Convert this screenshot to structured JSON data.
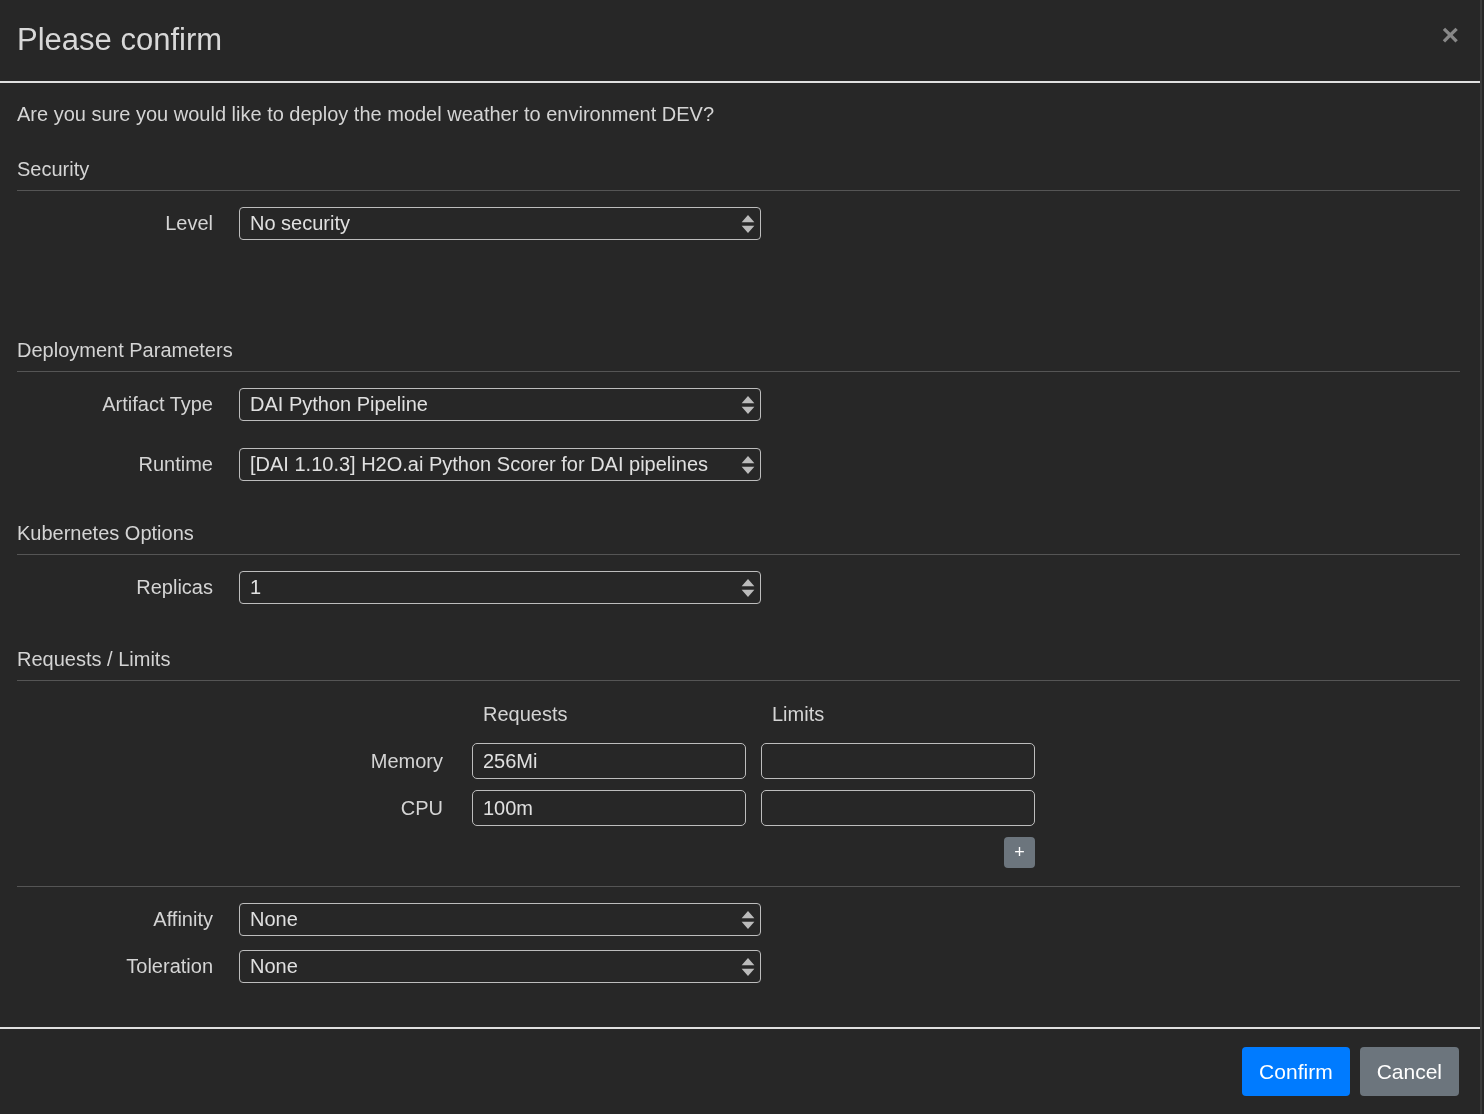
{
  "dialog": {
    "title": "Please confirm",
    "close": "×",
    "message": "Are you sure you would like to deploy the model weather to environment DEV?",
    "sections": [
      {
        "kind": "fields",
        "title": "Security",
        "fields": [
          {
            "label": "Level",
            "value": "No security"
          }
        ]
      },
      {
        "kind": "fields",
        "title": "Deployment Parameters",
        "fields": [
          {
            "label": "Artifact Type",
            "value": "DAI Python Pipeline"
          },
          {
            "label": "Runtime",
            "value": "[DAI 1.10.3] H2O.ai Python Scorer for DAI pipelines"
          }
        ]
      },
      {
        "kind": "fields",
        "title": "Kubernetes Options",
        "fields": [
          {
            "label": "Replicas",
            "value": "1"
          }
        ]
      },
      {
        "kind": "resources",
        "title": "Requests / Limits",
        "columns": [
          "Requests",
          "Limits"
        ],
        "rows": [
          {
            "label": "Memory",
            "requests": "256Mi"
          },
          {
            "label": "CPU",
            "requests": "100m"
          }
        ],
        "add": "+"
      },
      {
        "kind": "fields",
        "fields": [
          {
            "label": "Affinity",
            "value": "None"
          },
          {
            "label": "Toleration",
            "value": "None"
          }
        ]
      }
    ],
    "buttons": [
      {
        "label": "Confirm",
        "kind": "primary"
      },
      {
        "label": "Cancel",
        "kind": "secondary"
      }
    ]
  }
}
